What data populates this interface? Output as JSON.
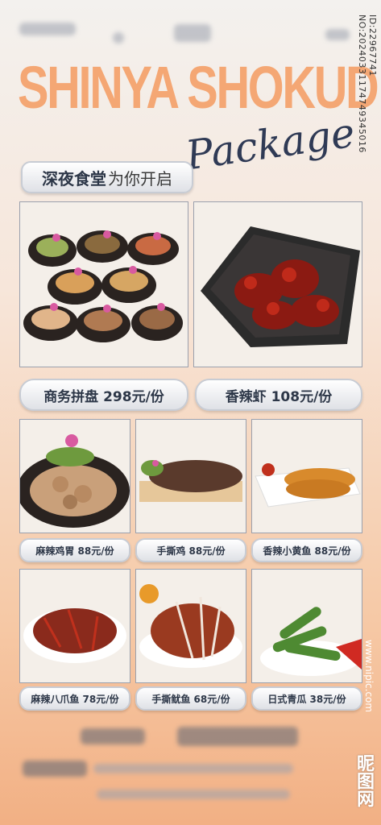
{
  "header": {
    "title": "SHINYA SHOKUD",
    "script": "Package",
    "subtitle_bold": "深夜食堂",
    "subtitle_rest": "为你开启"
  },
  "watermark": {
    "side_id": "ID:22967741 NO:20240331174749345016",
    "brand": "昵图网",
    "url": "www.nipic.com"
  },
  "featured": [
    {
      "label": "商务拼盘 298元/份"
    },
    {
      "label": "香辣虾 108元/份"
    }
  ],
  "dishes_row1": [
    {
      "label": "麻辣鸡胃 88元/份"
    },
    {
      "label": "手撕鸡 88元/份"
    },
    {
      "label": "香辣小黄鱼 88元/份"
    }
  ],
  "dishes_row2": [
    {
      "label": "麻辣八爪鱼 78元/份"
    },
    {
      "label": "手撕鱿鱼 68元/份"
    },
    {
      "label": "日式青瓜 38元/份"
    }
  ],
  "colors": {
    "accent": "#f4a774",
    "ink": "#2f3a55"
  }
}
